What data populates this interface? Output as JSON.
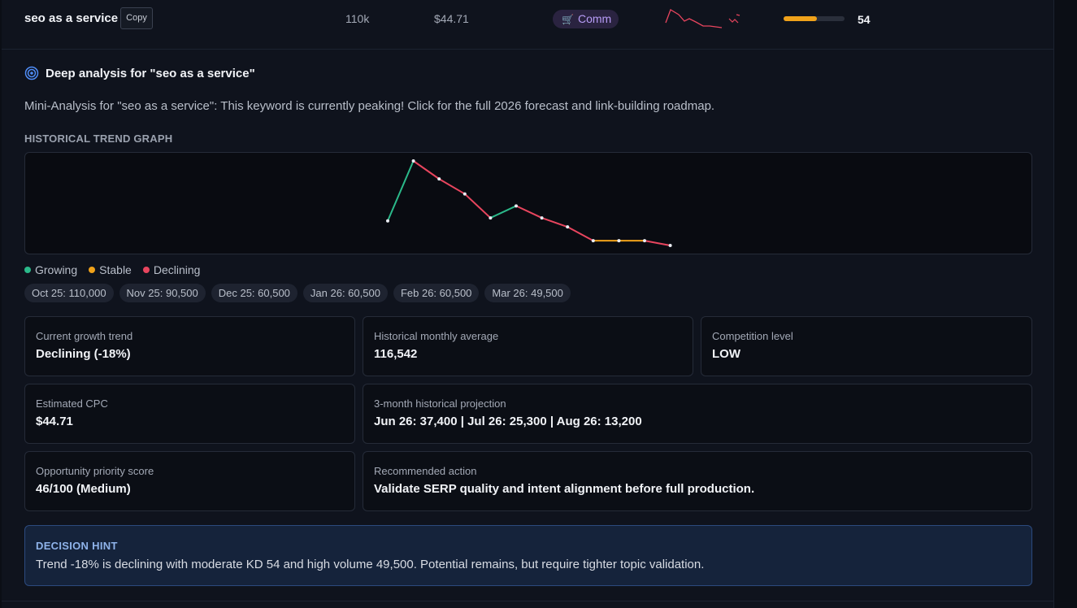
{
  "row": {
    "keyword": "seo as a service",
    "copy_label": "Copy",
    "volume": "110k",
    "cpc": "$44.71",
    "intent": "Comm",
    "intent_icon": "cart-icon",
    "kd": 54,
    "kd_fraction": 0.54,
    "accent": "#f0a21a",
    "intent_color": "#b79cf6"
  },
  "analysis": {
    "title": "Deep analysis for \"seo as a service\"",
    "mini": "Mini-Analysis for \"seo as a service\": This keyword is currently peaking! Click for the full 2026 forecast and link-building roadmap.",
    "trend_label": "HISTORICAL TREND GRAPH"
  },
  "chart_data": {
    "type": "line",
    "segment_colors": {
      "Growing": "#2bb98a",
      "Stable": "#f0a21a",
      "Declining": "#e8455e"
    },
    "legend": [
      "Growing",
      "Stable",
      "Declining"
    ],
    "values": [
      80000,
      180000,
      150000,
      125000,
      85000,
      105000,
      85000,
      70000,
      47000,
      47000,
      47000,
      39000
    ]
  },
  "legend": {
    "growing": "Growing",
    "stable": "Stable",
    "declining": "Declining",
    "colors": {
      "growing": "#2bb98a",
      "stable": "#f0a21a",
      "declining": "#e8455e"
    }
  },
  "chips": [
    "Oct 25: 110,000",
    "Nov 25: 90,500",
    "Dec 25: 60,500",
    "Jan 26: 60,500",
    "Feb 26: 60,500",
    "Mar 26: 49,500"
  ],
  "cards": {
    "growth": {
      "label": "Current growth trend",
      "value": "Declining (-18%)"
    },
    "avg": {
      "label": "Historical monthly average",
      "value": "116,542"
    },
    "competition": {
      "label": "Competition level",
      "value": "LOW"
    },
    "cpc": {
      "label": "Estimated CPC",
      "value": "$44.71"
    },
    "projection": {
      "label": "3-month historical projection",
      "value": "Jun 26: 37,400 | Jul 26: 25,300 | Aug 26: 13,200"
    },
    "priority": {
      "label": "Opportunity priority score",
      "value": "46/100 (Medium)"
    },
    "action": {
      "label": "Recommended action",
      "value": "Validate SERP quality and intent alignment before full production."
    }
  },
  "hint": {
    "title": "DECISION HINT",
    "body": "Trend -18% is declining with moderate KD 54 and high volume 49,500. Potential remains, but require tighter topic validation."
  }
}
